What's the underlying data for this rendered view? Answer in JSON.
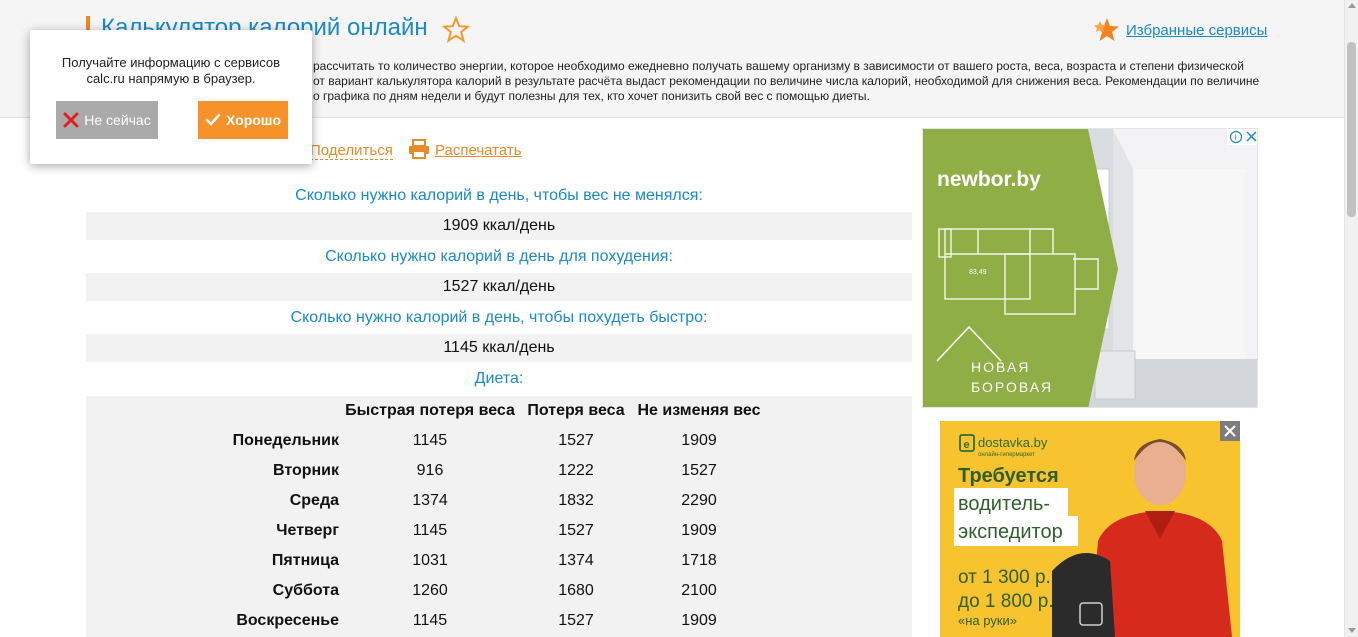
{
  "header": {
    "title": "Калькулятор калорий онлайн",
    "favorites_link": "Избранные сервисы",
    "description": [
      "рассчитать то количество энергии, которое необходимо ежедневно получать вашему организму в зависимости от вашего роста, веса, возраста и степени физической",
      "от вариант калькулятора калорий в результате расчёта выдаст рекомендации по величине числа калорий, необходимой для снижения веса. Рекомендации по величине",
      "о графика по дням недели и будут полезны для тех, кто хочет понизить свой вес с помощью диеты."
    ]
  },
  "popup": {
    "text_line1": "Получайте информацию с сервисов",
    "text_line2": "calc.ru напрямую в браузер.",
    "decline_label": "Не сейчас",
    "accept_label": "Хорошо"
  },
  "actions": {
    "share_label": "Поделиться",
    "print_label": "Распечатать"
  },
  "results": [
    {
      "question": "Сколько нужно калорий в день, чтобы вес не менялся:",
      "value": "1909 ккал/день"
    },
    {
      "question": "Сколько нужно калорий в день для похудения:",
      "value": "1527 ккал/день"
    },
    {
      "question": "Сколько нужно калорий в день, чтобы похудеть быстро:",
      "value": "1145 ккал/день"
    }
  ],
  "diet": {
    "heading": "Диета:",
    "columns": [
      "Быстрая потеря веса",
      "Потеря веса",
      "Не изменяя вес"
    ],
    "rows": [
      {
        "day": "Понедельник",
        "values": [
          "1145",
          "1527",
          "1909"
        ]
      },
      {
        "day": "Вторник",
        "values": [
          "916",
          "1222",
          "1527"
        ]
      },
      {
        "day": "Среда",
        "values": [
          "1374",
          "1832",
          "2290"
        ]
      },
      {
        "day": "Четверг",
        "values": [
          "1145",
          "1527",
          "1909"
        ]
      },
      {
        "day": "Пятница",
        "values": [
          "1031",
          "1374",
          "1718"
        ]
      },
      {
        "day": "Суббота",
        "values": [
          "1260",
          "1680",
          "2100"
        ]
      },
      {
        "day": "Воскресенье",
        "values": [
          "1145",
          "1527",
          "1909"
        ]
      }
    ]
  },
  "ads": {
    "ad1": {
      "brand": "newbor.by",
      "floor_area": "83,49",
      "logo_line1": "НОВАЯ",
      "logo_line2": "БОРОВАЯ",
      "bg_color": "#8fae46"
    },
    "ad2": {
      "brand": "dostavka.by",
      "brand_sub": "онлайн-гипермаркет",
      "line1": "Требуется",
      "line2": "водитель-",
      "line3": "экспедитор",
      "price1": "от 1 300 р.",
      "price2": "до 1 800 р.",
      "price_note": "«на руки»",
      "bg_color": "#f7c32e"
    }
  },
  "colors": {
    "accent": "#f58220",
    "link": "#1a8ac6"
  }
}
